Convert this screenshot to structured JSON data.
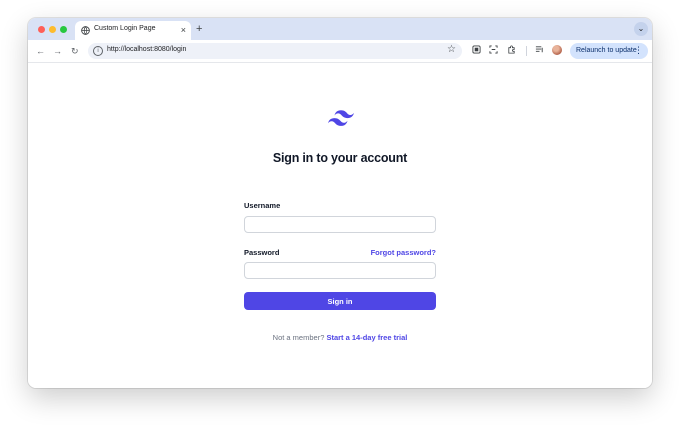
{
  "browser": {
    "tab": {
      "title": "Custom Login Page",
      "favicon": "globe-icon",
      "close": "×"
    },
    "new_tab": "+",
    "tab_menu": "⌄",
    "toolbar": {
      "back": "←",
      "forward": "→",
      "reload": "↻",
      "url": "http://localhost:8080/login",
      "star": "☆",
      "relaunch_label": "Relaunch to update",
      "menu_dots": "⋮"
    }
  },
  "page": {
    "logo": "tailwind-logo-icon",
    "heading": "Sign in to your account",
    "username": {
      "label": "Username",
      "value": "",
      "placeholder": ""
    },
    "password": {
      "label": "Password",
      "value": "",
      "placeholder": ""
    },
    "forgot_link": "Forgot password?",
    "submit_label": "Sign in",
    "member_text": "Not a member?",
    "trial_link": "Start a 14-day free trial"
  },
  "colors": {
    "accent": "#4f46e5",
    "titlebar": "#d9e2f5",
    "heading_text": "#111827",
    "muted_text": "#6b7280"
  }
}
